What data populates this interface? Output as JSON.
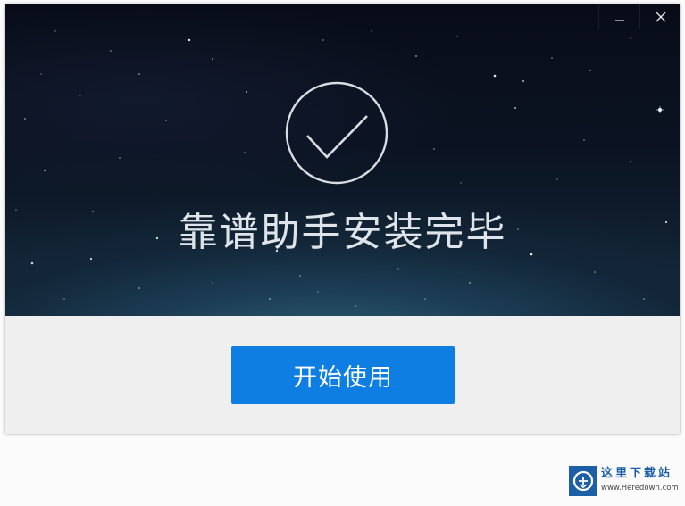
{
  "window": {
    "headline": "靠谱助手安装完毕",
    "start_button_label": "开始使用",
    "controls": {
      "minimize_icon": "minimize-icon",
      "close_icon": "close-icon"
    },
    "success_icon": "checkmark-circle-icon"
  },
  "watermark": {
    "title": "这里下载站",
    "url": "www.Heredown.com",
    "logo_icon": "heredown-logo-icon"
  },
  "colors": {
    "accent_button": "#0f7ee2",
    "banner_dark": "#0b1322",
    "panel_bg": "#efefef",
    "headline_text": "#dfe4ea"
  }
}
